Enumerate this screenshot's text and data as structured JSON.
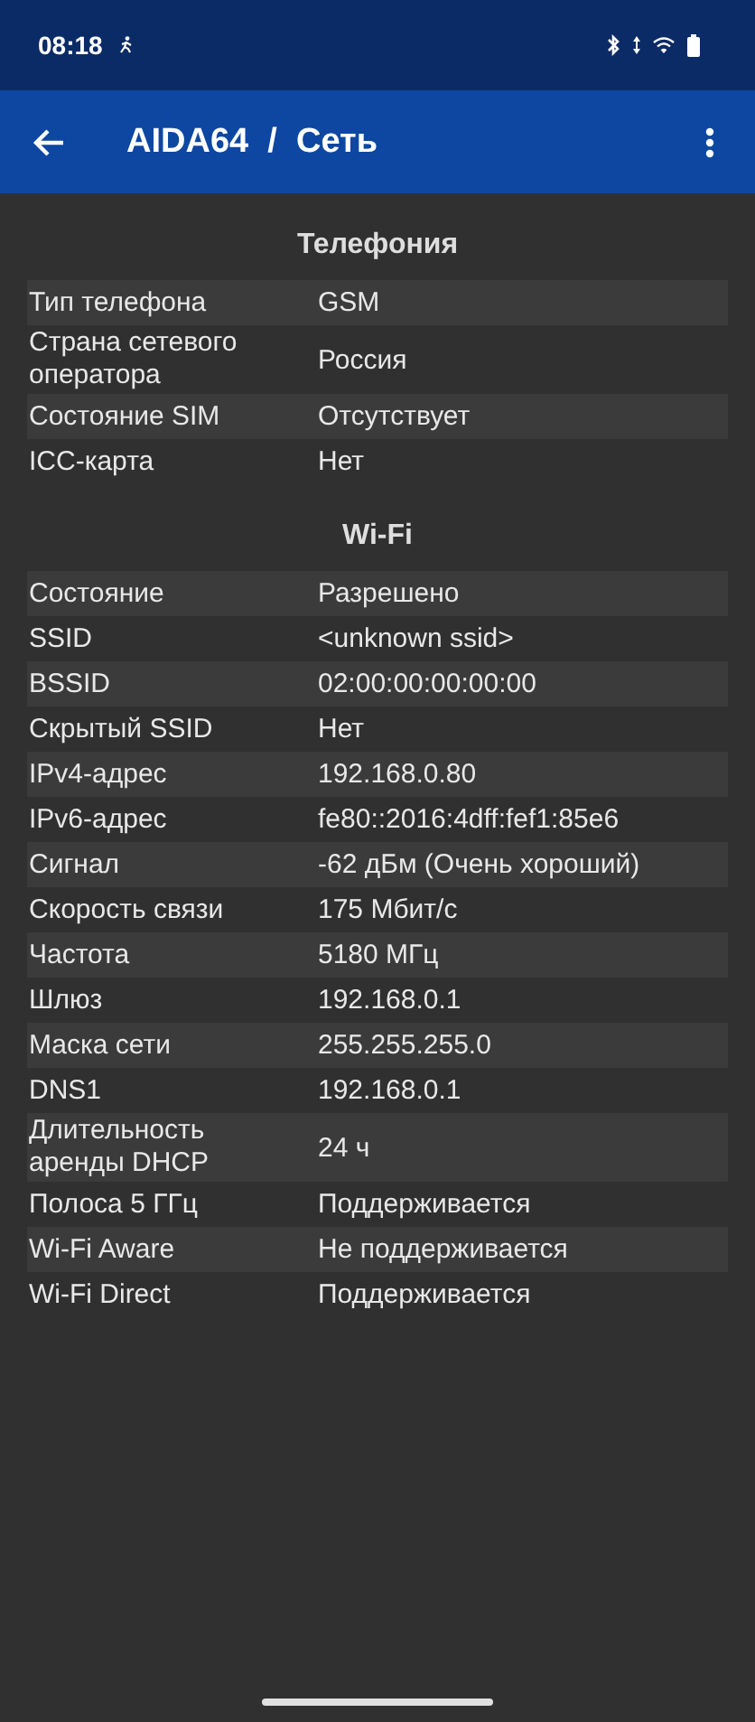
{
  "status_bar": {
    "time": "08:18"
  },
  "app_bar": {
    "title": "AIDA64  /  Сеть"
  },
  "sections": [
    {
      "title": "Телефония",
      "rows": [
        {
          "label": "Тип телефона",
          "value": "GSM"
        },
        {
          "label": "Страна сетевого оператора",
          "value": "Россия"
        },
        {
          "label": "Состояние SIM",
          "value": "Отсутствует"
        },
        {
          "label": "ICC-карта",
          "value": "Нет"
        }
      ]
    },
    {
      "title": "Wi-Fi",
      "rows": [
        {
          "label": "Состояние",
          "value": "Разрешено"
        },
        {
          "label": "SSID",
          "value": "<unknown ssid>"
        },
        {
          "label": "BSSID",
          "value": "02:00:00:00:00:00"
        },
        {
          "label": "Скрытый SSID",
          "value": "Нет"
        },
        {
          "label": "IPv4-адрес",
          "value": "192.168.0.80"
        },
        {
          "label": "IPv6-адрес",
          "value": "fe80::2016:4dff:fef1:85e6"
        },
        {
          "label": "Сигнал",
          "value": "-62 дБм (Очень хороший)"
        },
        {
          "label": "Скорость связи",
          "value": "175 Мбит/с"
        },
        {
          "label": "Частота",
          "value": "5180 МГц"
        },
        {
          "label": "Шлюз",
          "value": "192.168.0.1"
        },
        {
          "label": "Маска сети",
          "value": "255.255.255.0"
        },
        {
          "label": "DNS1",
          "value": "192.168.0.1"
        },
        {
          "label": "Длительность аренды DHCP",
          "value": "24 ч"
        },
        {
          "label": "Полоса 5 ГГц",
          "value": "Поддерживается"
        },
        {
          "label": "Wi-Fi Aware",
          "value": "Не поддерживается"
        },
        {
          "label": "Wi-Fi Direct",
          "value": "Поддерживается"
        }
      ]
    }
  ]
}
